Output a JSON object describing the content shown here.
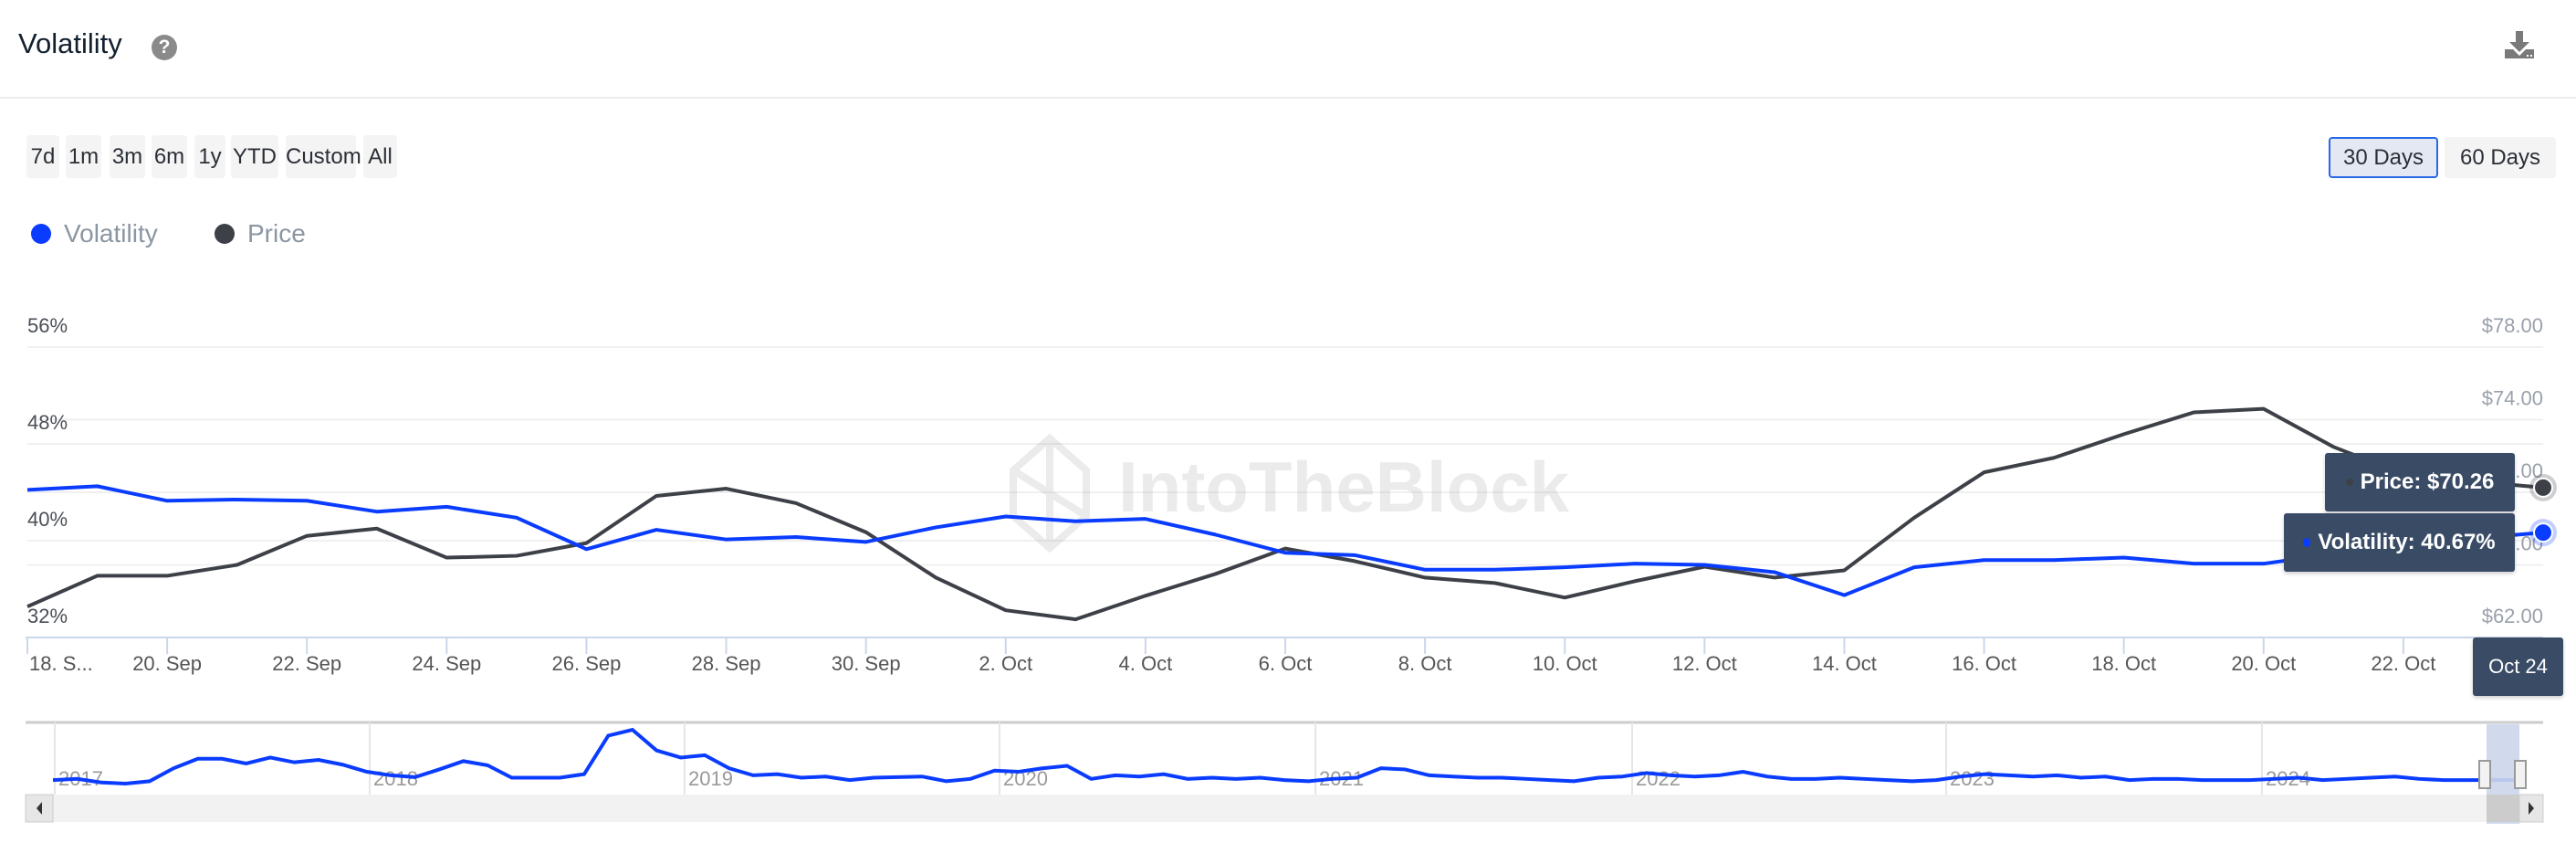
{
  "header": {
    "title": "Volatility",
    "help_icon": "question-circle-icon",
    "download_icon": "download-icon"
  },
  "range_buttons": [
    "7d",
    "1m",
    "3m",
    "6m",
    "1y",
    "YTD",
    "Custom",
    "All"
  ],
  "period_buttons": [
    {
      "label": "30 Days",
      "active": true
    },
    {
      "label": "60 Days",
      "active": false
    }
  ],
  "watermark": "IntoTheBlock",
  "tooltip": {
    "price": "Price: $70.26",
    "volatility": "Volatility: 40.67%",
    "date": "Oct 24"
  },
  "chart_data": {
    "type": "line",
    "title": "",
    "legend": {
      "position": "top-left",
      "entries": [
        "Volatility",
        "Price"
      ]
    },
    "grid": true,
    "x": [
      "18 Sep",
      "19 Sep",
      "20 Sep",
      "21 Sep",
      "22 Sep",
      "23 Sep",
      "24 Sep",
      "25 Sep",
      "26 Sep",
      "27 Sep",
      "28 Sep",
      "29 Sep",
      "30 Sep",
      "1 Oct",
      "2 Oct",
      "3 Oct",
      "4 Oct",
      "5 Oct",
      "6 Oct",
      "7 Oct",
      "8 Oct",
      "9 Oct",
      "10 Oct",
      "11 Oct",
      "12 Oct",
      "13 Oct",
      "14 Oct",
      "15 Oct",
      "16 Oct",
      "17 Oct",
      "18 Oct",
      "19 Oct",
      "20 Oct",
      "21 Oct",
      "22 Oct",
      "23 Oct",
      "24 Oct"
    ],
    "x_tick_labels": [
      "18. S...",
      "20. Sep",
      "22. Sep",
      "24. Sep",
      "26. Sep",
      "28. Sep",
      "30. Sep",
      "2. Oct",
      "4. Oct",
      "6. Oct",
      "8. Oct",
      "10. Oct",
      "12. Oct",
      "14. Oct",
      "16. Oct",
      "18. Oct",
      "20. Oct",
      "22. Oct"
    ],
    "y_left": {
      "ticks": [
        "56%",
        "48%",
        "40%",
        "32%"
      ],
      "range": [
        32,
        56
      ]
    },
    "y_right": {
      "ticks": [
        "$78.00",
        "$74.00",
        "$70.00",
        "$66.00",
        "$62.00"
      ],
      "range": [
        62,
        78
      ]
    },
    "series": [
      {
        "name": "Volatility",
        "axis": "left",
        "color": "#0a3cff",
        "values": [
          44.2,
          44.5,
          43.3,
          43.4,
          43.3,
          42.4,
          42.8,
          41.9,
          39.3,
          40.9,
          40.1,
          40.3,
          39.9,
          41.1,
          42.0,
          41.6,
          41.8,
          40.5,
          39.0,
          38.8,
          37.6,
          37.6,
          37.8,
          38.1,
          38.0,
          37.4,
          35.5,
          37.8,
          38.4,
          38.4,
          38.6,
          38.1,
          38.1,
          38.9,
          39.8,
          40.2,
          40.67
        ]
      },
      {
        "name": "Price",
        "axis": "right",
        "color": "#3d4147",
        "values": [
          63.7,
          65.4,
          65.4,
          66.0,
          67.6,
          68.0,
          66.4,
          66.5,
          67.2,
          69.8,
          70.2,
          69.4,
          67.8,
          65.3,
          63.5,
          63.0,
          64.3,
          65.5,
          66.9,
          66.2,
          65.3,
          65.0,
          64.2,
          65.1,
          65.9,
          65.3,
          65.7,
          68.6,
          71.1,
          71.9,
          73.2,
          74.4,
          74.6,
          72.5,
          71.0,
          70.6,
          70.26
        ]
      }
    ],
    "navigator": {
      "year_labels": [
        "2017",
        "2018",
        "2019",
        "2020",
        "2021",
        "2022",
        "2023",
        "2024"
      ],
      "values": [
        50,
        52,
        46,
        44,
        48,
        70,
        86,
        86,
        78,
        88,
        80,
        84,
        76,
        64,
        58,
        55,
        68,
        82,
        75,
        54,
        54,
        54,
        60,
        125,
        135,
        100,
        88,
        92,
        70,
        58,
        60,
        54,
        56,
        50,
        54,
        55,
        56,
        48,
        52,
        66,
        64,
        70,
        74,
        52,
        58,
        56,
        60,
        52,
        54,
        52,
        54,
        50,
        48,
        52,
        54,
        70,
        68,
        58,
        56,
        54,
        54,
        52,
        50,
        48,
        54,
        56,
        62,
        58,
        56,
        58,
        64,
        56,
        52,
        52,
        54,
        52,
        50,
        48,
        50,
        56,
        60,
        58,
        56,
        58,
        54,
        56,
        50,
        52,
        52,
        50,
        50,
        50,
        52,
        54,
        50,
        52,
        54,
        56,
        52,
        50,
        50,
        50,
        50
      ]
    }
  }
}
